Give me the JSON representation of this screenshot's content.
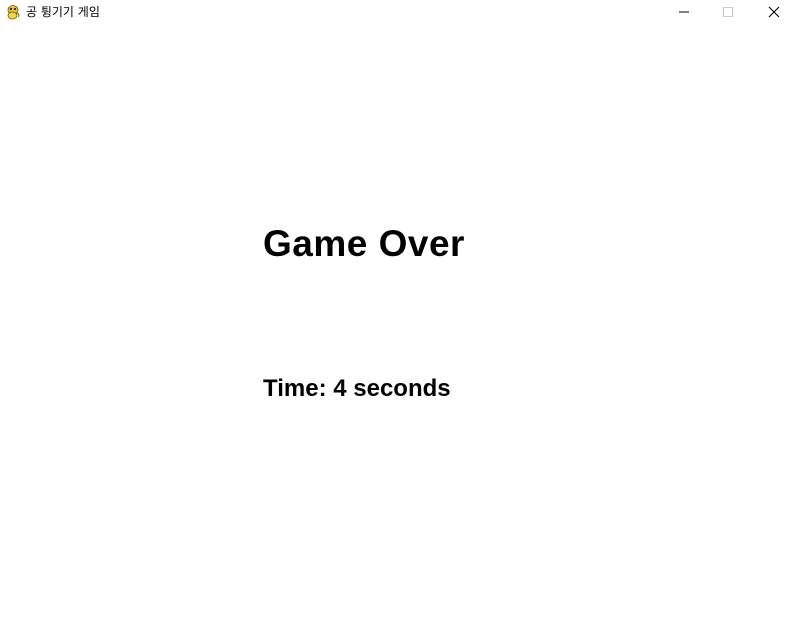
{
  "window": {
    "title": "공 튕기기 게임",
    "icon": "python-snake-icon",
    "controls": {
      "minimize": "minimize-icon",
      "maximize": "maximize-icon",
      "close": "close-icon"
    }
  },
  "game": {
    "status_text": "Game Over",
    "time_text": "Time: 4 seconds",
    "background_color": "#ffffff",
    "text_color": "#000000"
  }
}
